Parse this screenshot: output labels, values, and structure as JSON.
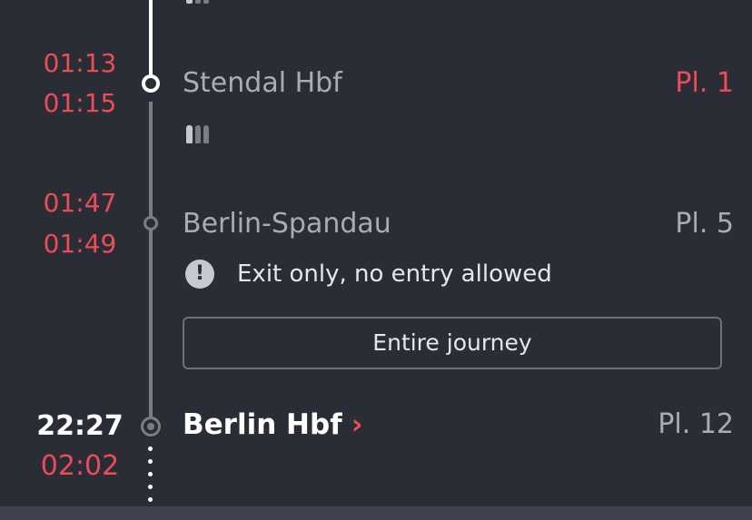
{
  "stops": [
    {
      "arrival": "01:13",
      "departure": "01:15",
      "name": "Stendal Hbf",
      "platform": "Pl. 1"
    },
    {
      "arrival": "01:47",
      "departure": "01:49",
      "name": "Berlin-Spandau",
      "platform": "Pl. 5",
      "notice": "Exit only, no entry allowed"
    }
  ],
  "entire_journey_label": "Entire journey",
  "destination": {
    "scheduled": "22:27",
    "actual": "02:02",
    "name": "Berlin Hbf",
    "chevron": "›",
    "platform": "Pl. 12"
  },
  "info_icon_glyph": "!",
  "colors": {
    "background": "#2a2d36",
    "delay_red": "#ec4d55",
    "line_grey": "#7a7d86",
    "text_grey": "#a9acb3"
  }
}
